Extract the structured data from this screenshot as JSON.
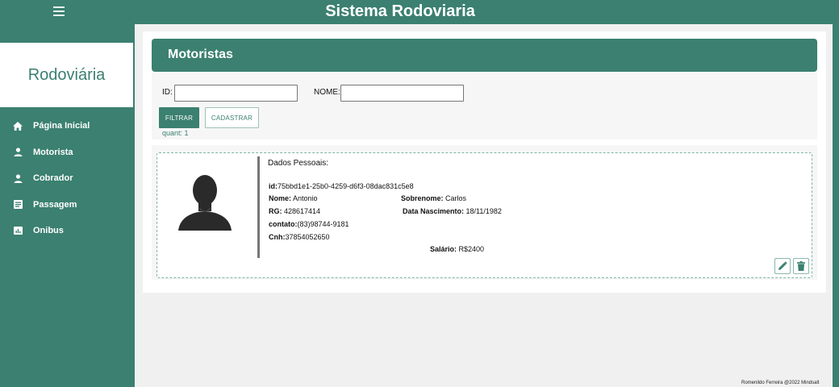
{
  "app": {
    "title": "Sistema Rodoviaria"
  },
  "sidebar": {
    "brand": "Rodoviária",
    "items": [
      {
        "label": "Página Inicial",
        "icon": "home-icon"
      },
      {
        "label": "Motorista",
        "icon": "person-icon"
      },
      {
        "label": "Cobrador",
        "icon": "person-icon"
      },
      {
        "label": "Passagem",
        "icon": "list-icon"
      },
      {
        "label": "Onibus",
        "icon": "chart-icon"
      }
    ]
  },
  "page": {
    "title": "Motoristas",
    "filters": {
      "id_label": "ID:",
      "id_value": "",
      "nome_label": "NOME:",
      "nome_value": ""
    },
    "buttons": {
      "filter": "FILTRAR",
      "register": "CADASTRAR"
    },
    "count": "quant: 1"
  },
  "record": {
    "section": "Dados Pessoais:",
    "id_label": "id:",
    "id": "75bbd1e1-25b0-4259-d6f3-08dac831c5e8",
    "nome_label": "Nome:",
    "nome": "Antonio",
    "sobrenome_label": "Sobrenome:",
    "sobrenome": "Carlos",
    "rg_label": "RG:",
    "rg": "428617414",
    "nascimento_label": "Data Nascimento:",
    "nascimento": "18/11/1982",
    "contato_label": "contato:",
    "contato": "(83)98744-9181",
    "cnh_label": "Cnh:",
    "cnh": "37854052650",
    "salario_label": "Salário:",
    "salario": "R$2400"
  },
  "footer": "Romenildo Ferreira @2022 Mindsalt",
  "colors": {
    "primary": "#3b8070",
    "background": "#f0f0f1"
  }
}
